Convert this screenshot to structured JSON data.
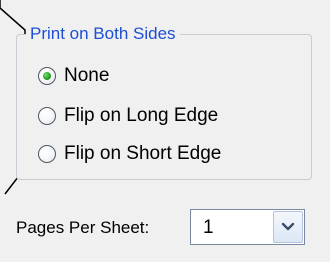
{
  "duplex": {
    "title": "Print on Both Sides",
    "options": [
      {
        "label": "None",
        "selected": true
      },
      {
        "label": "Flip on Long Edge",
        "selected": false
      },
      {
        "label": "Flip on Short Edge",
        "selected": false
      }
    ]
  },
  "pages_per_sheet": {
    "label": "Pages Per Sheet:",
    "value": "1"
  },
  "icons": {
    "dropdown": "chevron-down-icon",
    "selected_radio": "radio-selected-indicator"
  },
  "colors": {
    "group_title": "#1c4fd6",
    "background": "#f0f0f0",
    "radio_selected": "#25a322"
  }
}
